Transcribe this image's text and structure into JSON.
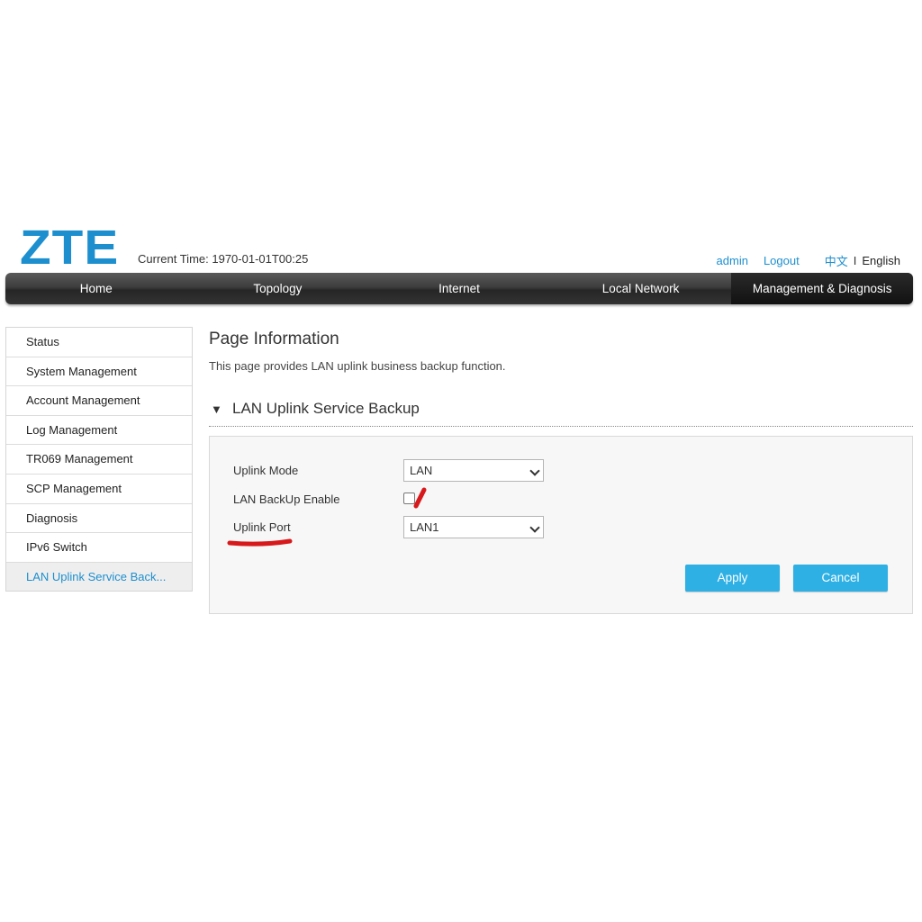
{
  "header": {
    "logo": "ZTE",
    "current_time": "Current Time: 1970-01-01T00:25",
    "user": "admin",
    "logout": "Logout",
    "lang_cn": "中文",
    "lang_sep": "I",
    "lang_en": "English"
  },
  "nav": {
    "items": [
      "Home",
      "Topology",
      "Internet",
      "Local Network",
      "Management & Diagnosis"
    ],
    "active": "Management & Diagnosis"
  },
  "sidebar": {
    "items": [
      "Status",
      "System Management",
      "Account Management",
      "Log Management",
      "TR069 Management",
      "SCP Management",
      "Diagnosis",
      "IPv6 Switch",
      "LAN Uplink Service Back..."
    ],
    "active": "LAN Uplink Service Back..."
  },
  "main": {
    "page_title": "Page Information",
    "page_desc": "This page provides LAN uplink business backup function.",
    "section_title": "LAN Uplink Service Backup",
    "form": {
      "uplink_mode_label": "Uplink Mode",
      "uplink_mode_value": "LAN",
      "backup_enable_label": "LAN BackUp Enable",
      "backup_enable_checked": false,
      "uplink_port_label": "Uplink Port",
      "uplink_port_value": "LAN1"
    },
    "apply_label": "Apply",
    "cancel_label": "Cancel"
  },
  "colors": {
    "brand": "#1d8fcf",
    "button": "#2eb0e4",
    "annotation": "#d7191c"
  }
}
